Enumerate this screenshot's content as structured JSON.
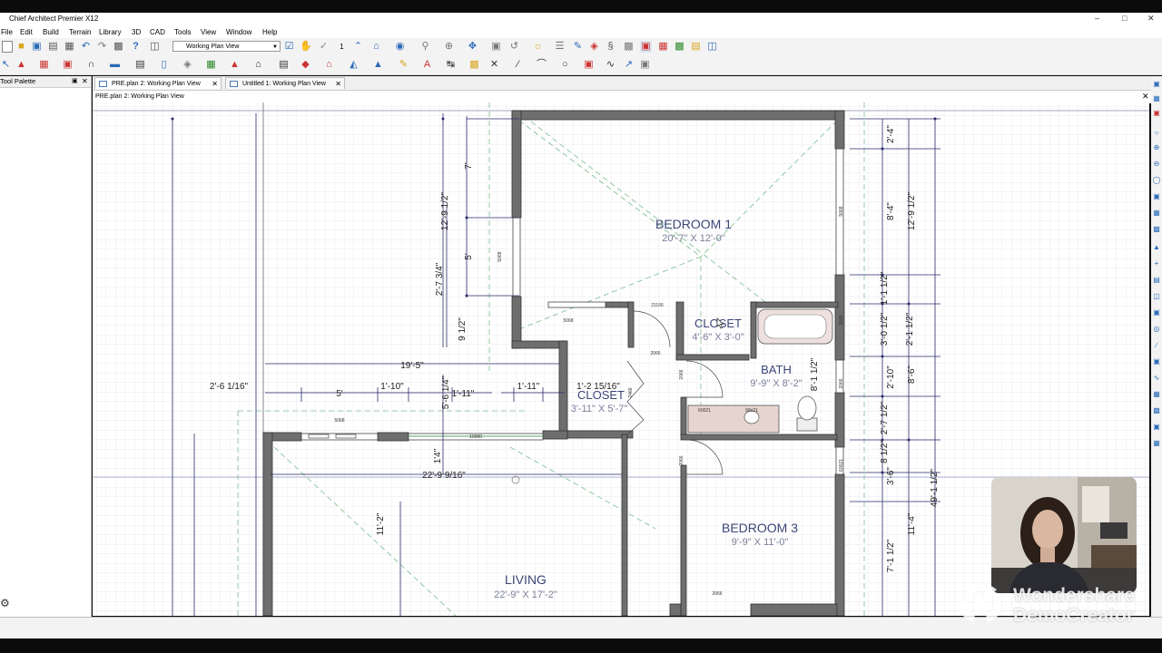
{
  "window": {
    "title": "Chief Architect Premier X12"
  },
  "menu": [
    "File",
    "Edit",
    "Build",
    "Terrain",
    "Library",
    "3D",
    "CAD",
    "Tools",
    "View",
    "Window",
    "Help"
  ],
  "toolbar": {
    "view_dropdown": "Working Plan View",
    "number": "1"
  },
  "palette": {
    "title": "Tool Palette"
  },
  "tabs": [
    {
      "label": "PRE.plan 2:  Working Plan View",
      "active": true
    },
    {
      "label": "Untitled 1:  Working Plan View",
      "active": false
    }
  ],
  "view": {
    "header": "PRE.plan 2:  Working Plan View"
  },
  "plan": {
    "rooms": [
      {
        "name": "BEDROOM 1",
        "size": "20'-7\" X 12'-0\""
      },
      {
        "name": "CLOSET",
        "size": "4'-6\" X 3'-0\""
      },
      {
        "name": "BATH",
        "size": "9'-9\" X 8'-2\""
      },
      {
        "name": "CLOSET",
        "size": "3'-11\" X 5'-7\""
      },
      {
        "name": "BEDROOM 3",
        "size": "9'-9\" X 11'-0\""
      },
      {
        "name": "LIVING",
        "size": "22'-9\" X 17'-2\""
      }
    ],
    "dimensions": {
      "d19_5": "19'-5\"",
      "d2_6": "2'-6 1/16\"",
      "d5": "5'",
      "d1_10": "1'-10\"",
      "d1_11a": "1'-11\"",
      "d1_11b": "1'-11\"",
      "d1_2": "1'-2 15/16\"",
      "d22_9": "22'-9 9/16\"",
      "d11_2": "11'-2\"",
      "d1_4": "1'4\"",
      "d5_6": "5'-6 1/4\"",
      "d12_9a": "12'-9 1/2\"",
      "d7": "7'",
      "d5b": "5'",
      "d2_7": "2'-7 3/4\"",
      "d9_1": "9 1/2\"",
      "r2_4": "2'-4\"",
      "r8_4": "8'-4\"",
      "r12_9": "12'-9 1/2\"",
      "r1_1": "1'-1 1/2\"",
      "r3_0": "3'-0 1/2\"",
      "r2_1": "2'-1 1/2\"",
      "r8_1": "8'-1 1/2\"",
      "r2_10": "2'-10\"",
      "r8_6": "8'-6\"",
      "r2_7": "2'-7 1/2\"",
      "r8_1b": "8 1/2\"",
      "r3_6": "3'-6\"",
      "r11_4": "11'-4\"",
      "r7_1": "7'-1 1/2\"",
      "r49_1": "49'-1 1/2\"",
      "r11_2": "11'-2\""
    },
    "labels": {
      "w5068a": "5068",
      "w5068b": "5068",
      "w5068c": "5068",
      "w5068d": "5068",
      "w10080": "10080",
      "d2066a": "2066",
      "d2066b": "2066",
      "d2066c": "2066",
      "d2066d": "2066",
      "d2066e": "2066",
      "d21166": "21166",
      "d2466": "2466",
      "d3068": "3068",
      "s6021a": "60021",
      "s6021b": "58x21",
      "s6021c": "60021"
    }
  },
  "watermark": {
    "brand": "Wondershare",
    "product": "DemoCreator"
  },
  "colors": {
    "wall": "#666666",
    "dimension": "#2a2a6a",
    "grid": "#e3e3ea",
    "room_size": "#7a7f98",
    "room_name": "#3c4677"
  }
}
